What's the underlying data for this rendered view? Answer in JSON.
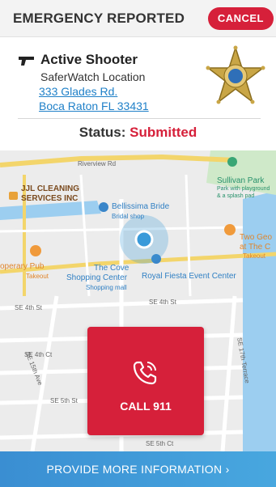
{
  "header": {
    "title": "EMERGENCY REPORTED",
    "cancel_label": "CANCEL"
  },
  "incident": {
    "type": "Active Shooter",
    "location_source": "SaferWatch Location",
    "address_line1": "333 Glades Rd.",
    "address_line2": "Boca Raton FL 33431",
    "icon": "handgun-icon",
    "badge": "sheriff-star-badge"
  },
  "status": {
    "label": "Status:",
    "value": "Submitted"
  },
  "map": {
    "streets": [
      "Riverview Rd",
      "SE 4th St",
      "SE 4th St",
      "SE 4th Ct",
      "SE 5th Ct",
      "SE 15th Ave",
      "SE 5th St",
      "SE 17th Terrace",
      "SE 5th Ct"
    ],
    "pois": {
      "jjl_line1": "JJL CLEANING",
      "jjl_line2": "SERVICES INC",
      "bellissima": "Bellissima Bride",
      "bellissima_sub": "Bridal shop",
      "sullivan": "Sullivan Park",
      "sullivan_sub1": "Park with playground",
      "sullivan_sub2": "& a splash pad",
      "two_geo1": "Two Geo",
      "two_geo2": "at The C",
      "two_geo3": "Takeout",
      "opera_pub": "operary Pub",
      "opera_pub_sub": "Takeout",
      "cove1": "The Cove",
      "cove2": "Shopping Center",
      "cove_sub": "Shopping mall",
      "royal": "Royal Fiesta Event Center"
    },
    "colors": {
      "water": "#9ccef0",
      "park": "#cfe9c9",
      "location": "#3a9ad9"
    }
  },
  "call": {
    "label": "CALL 911",
    "icon": "phone-ringing-icon",
    "color": "#d6203a"
  },
  "footer": {
    "more_label": "PROVIDE MORE INFORMATION",
    "chevron": "›"
  }
}
